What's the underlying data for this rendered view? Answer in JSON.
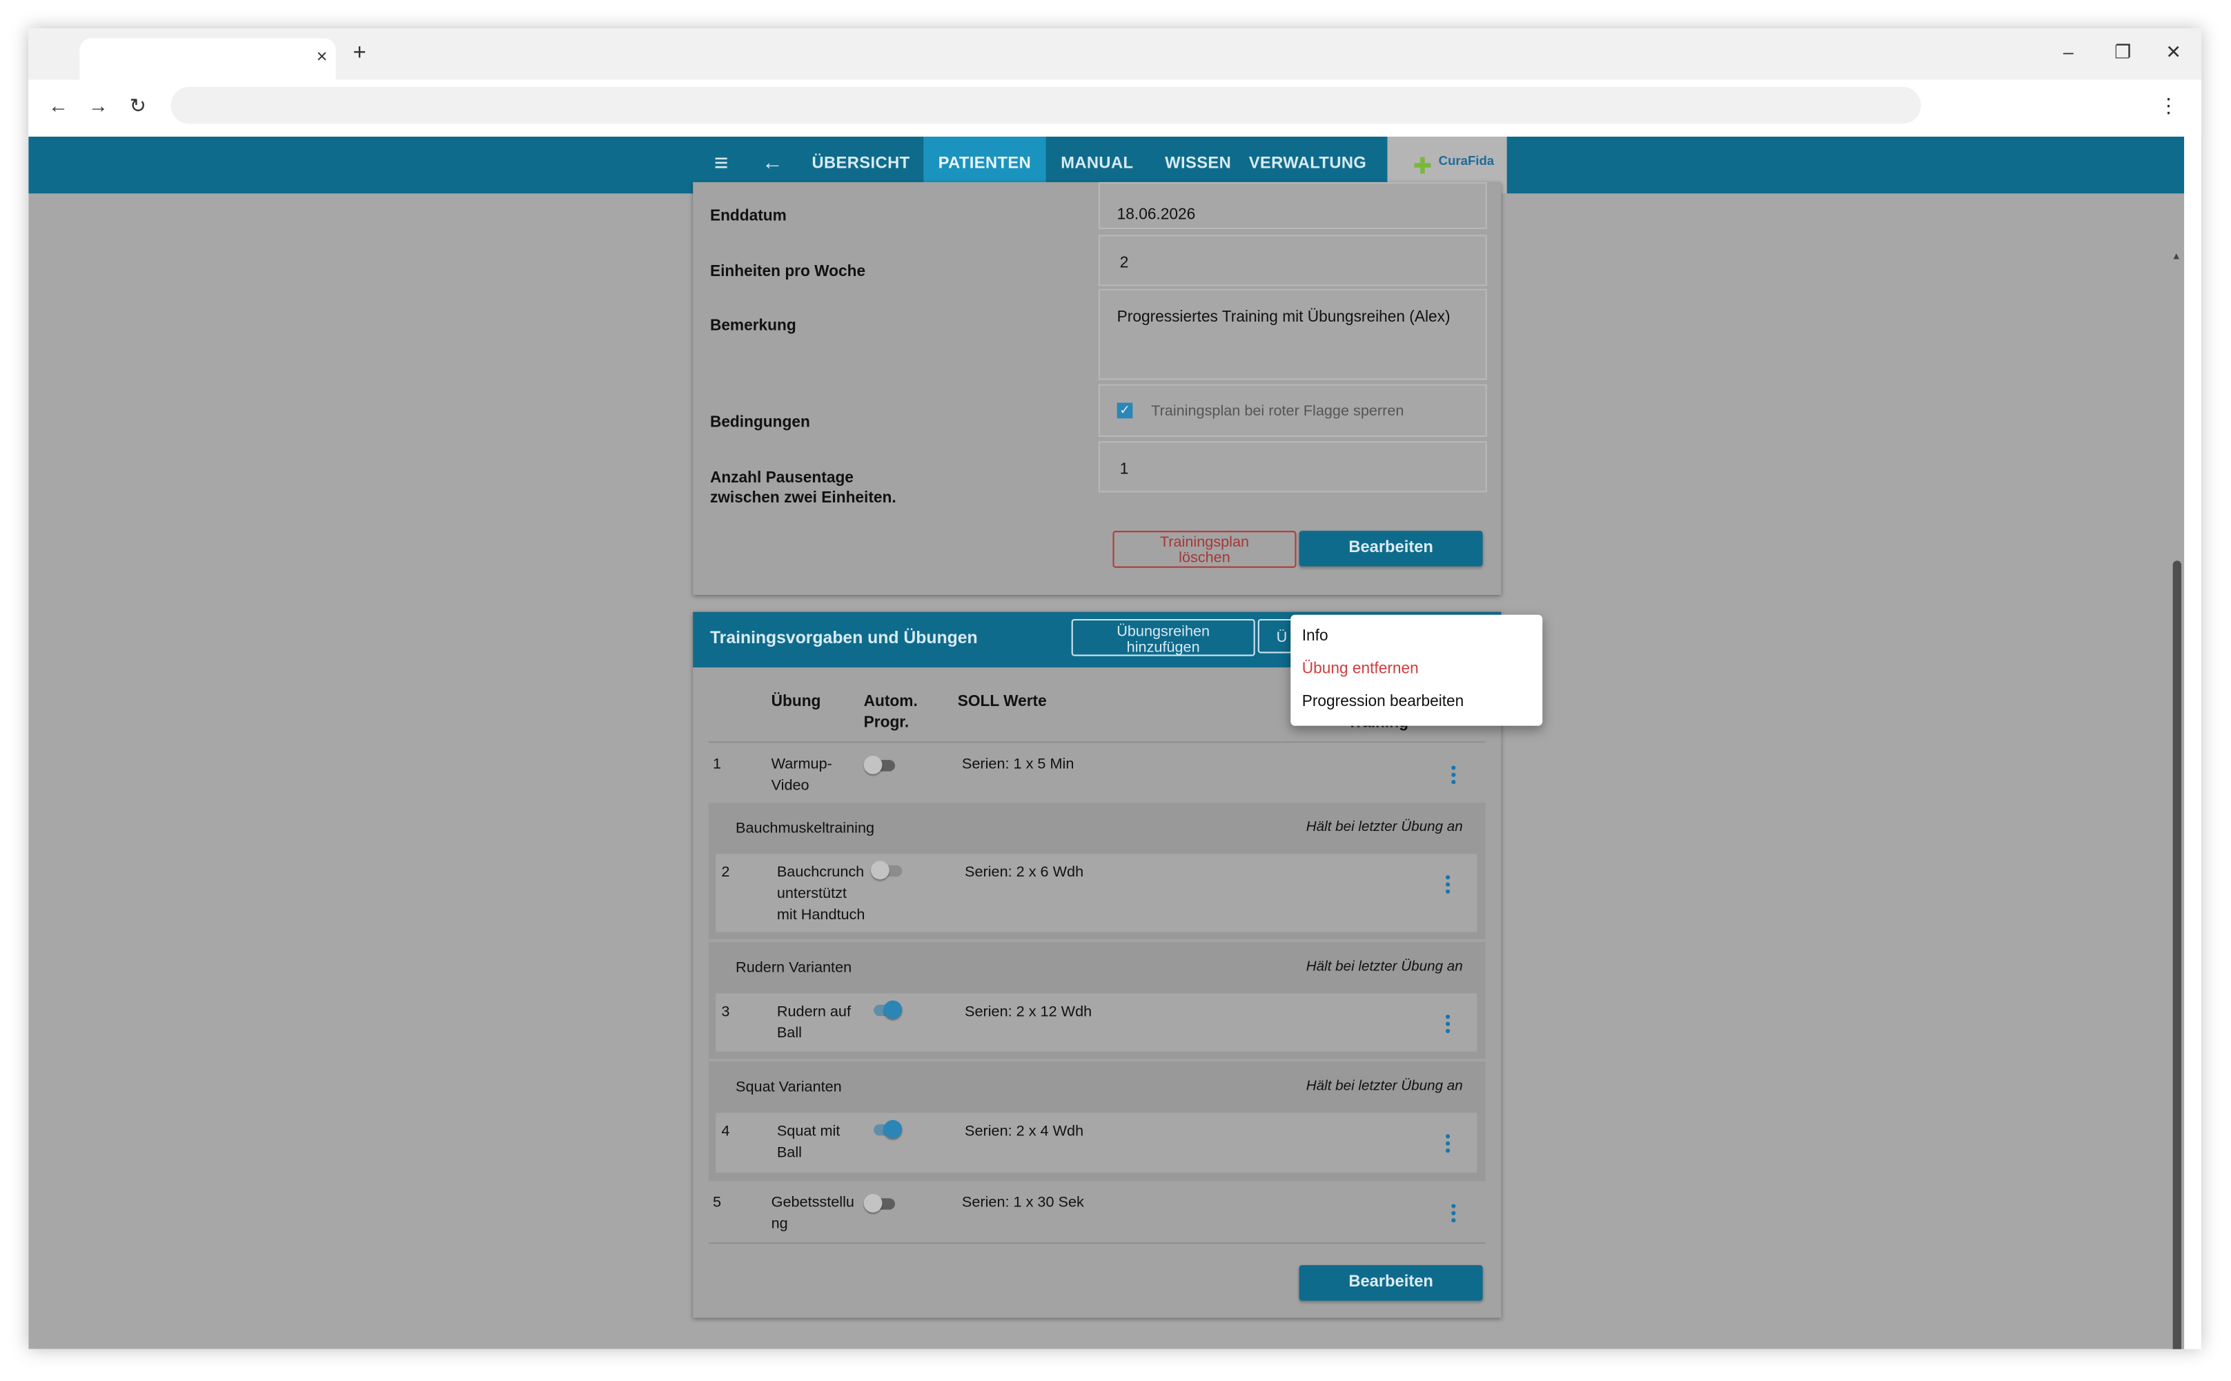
{
  "browser": {
    "tab_close": "×",
    "new_tab": "+",
    "window_controls": [
      "–",
      "❐",
      "✕"
    ],
    "nav": {
      "back": "←",
      "forward": "→",
      "reload": "↻"
    },
    "menu": "⋮"
  },
  "appbar": {
    "menu_icon": "≡",
    "back_icon": "←",
    "items": [
      "ÜBERSICHT",
      "PATIENTEN",
      "MANUAL",
      "WISSEN",
      "VERWALTUNG"
    ],
    "active_item": "PATIENTEN",
    "logo_text": "CuraFida"
  },
  "plan": {
    "rows": [
      {
        "label": "Enddatum",
        "value": "18.06.2026"
      },
      {
        "label": "Einheiten pro Woche",
        "value": "2"
      },
      {
        "label": "Bemerkung",
        "value": "Progressiertes Training mit Übungsreihen (Alex)"
      },
      {
        "label": "Bedingungen",
        "checkbox_label": "Trainingsplan bei roter Flagge sperren",
        "checked": true
      },
      {
        "label_line1": "Anzahl Pausentage",
        "label_line2": "zwischen zwei Einheiten.",
        "value": "1"
      }
    ],
    "delete_btn_line1": "Trainingsplan",
    "delete_btn_line2": "löschen",
    "edit_btn": "Bearbeiten"
  },
  "exercises": {
    "title": "Trainingsvorgaben und Übungen",
    "add_series_line1": "Übungsreihen",
    "add_series_line2": "hinzufügen",
    "add_exercise_partial": "Ü",
    "headers": {
      "uebung": "Übung",
      "autom_line1": "Autom.",
      "autom_line2": "Progr.",
      "soll": "SOLL Werte",
      "training_partial": "Training"
    },
    "rows": [
      {
        "num": "1",
        "name_line1": "Warmup-",
        "name_line2": "Video",
        "soll": "Serien: 1 x 5 Min",
        "auto_progression": false
      },
      {
        "group": "Bauchmuskeltraining",
        "note": "Hält bei letzter Übung an",
        "num": "2",
        "name_line1": "Bauchcrunch",
        "name_line2": "unterstützt",
        "name_line3": "mit Handtuch",
        "soll": "Serien: 2 x 6 Wdh",
        "auto_progression": false
      },
      {
        "group": "Rudern Varianten",
        "note": "Hält bei letzter Übung an",
        "num": "3",
        "name_line1": "Rudern auf",
        "name_line2": "Ball",
        "soll": "Serien: 2 x 12 Wdh",
        "auto_progression": true
      },
      {
        "group": "Squat Varianten",
        "note": "Hält bei letzter Übung an",
        "num": "4",
        "name_line1": "Squat mit",
        "name_line2": "Ball",
        "soll": "Serien: 2 x 4 Wdh",
        "auto_progression": true
      },
      {
        "num": "5",
        "name_line1": "Gebetsstellu",
        "name_line2": "ng",
        "soll": "Serien: 1 x 30 Sek",
        "auto_progression": false
      }
    ],
    "edit_btn": "Bearbeiten"
  },
  "context_menu": {
    "items": [
      "Info",
      "Übung entfernen",
      "Progression bearbeiten"
    ]
  },
  "colors": {
    "primary": "#0f6b8c",
    "active_tab": "#1b93bf",
    "danger": "#d23c3c",
    "overlay_gray": "#a7a7a7"
  }
}
